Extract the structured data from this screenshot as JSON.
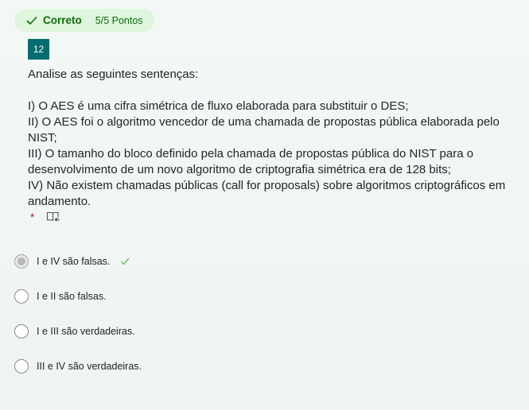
{
  "result": {
    "status": "Correto",
    "score": "5/5 Pontos",
    "status_icon": "check-icon",
    "color": "#0e6b0e"
  },
  "question": {
    "number": "12",
    "lines": [
      "Analise as seguintes sentenças:",
      "",
      "I) O AES é uma cifra simétrica de fluxo elaborada para substituir o DES;",
      "II) O AES foi o algoritmo vencedor de uma chamada de propostas pública elaborada pelo",
      "NIST;",
      "III) O tamanho do bloco definido pela chamada de propostas pública do NIST para o",
      "desenvolvimento de um novo algoritmo de criptografia simétrica era de 128 bits;",
      "IV) Não existem chamadas públicas (call for proposals) sobre algoritmos criptográficos em",
      "andamento."
    ],
    "required_mark": "*",
    "reader_icon": "immersive-reader-icon"
  },
  "options": [
    {
      "label": "I e IV são falsas.",
      "selected": true,
      "correct": true
    },
    {
      "label": "I e II são falsas.",
      "selected": false,
      "correct": false
    },
    {
      "label": "I e III são verdadeiras.",
      "selected": false,
      "correct": false
    },
    {
      "label": "III e IV são verdadeiras.",
      "selected": false,
      "correct": false
    }
  ],
  "colors": {
    "accent": "#036c70",
    "success_bg": "#dff6dd",
    "required": "#a4262c"
  }
}
